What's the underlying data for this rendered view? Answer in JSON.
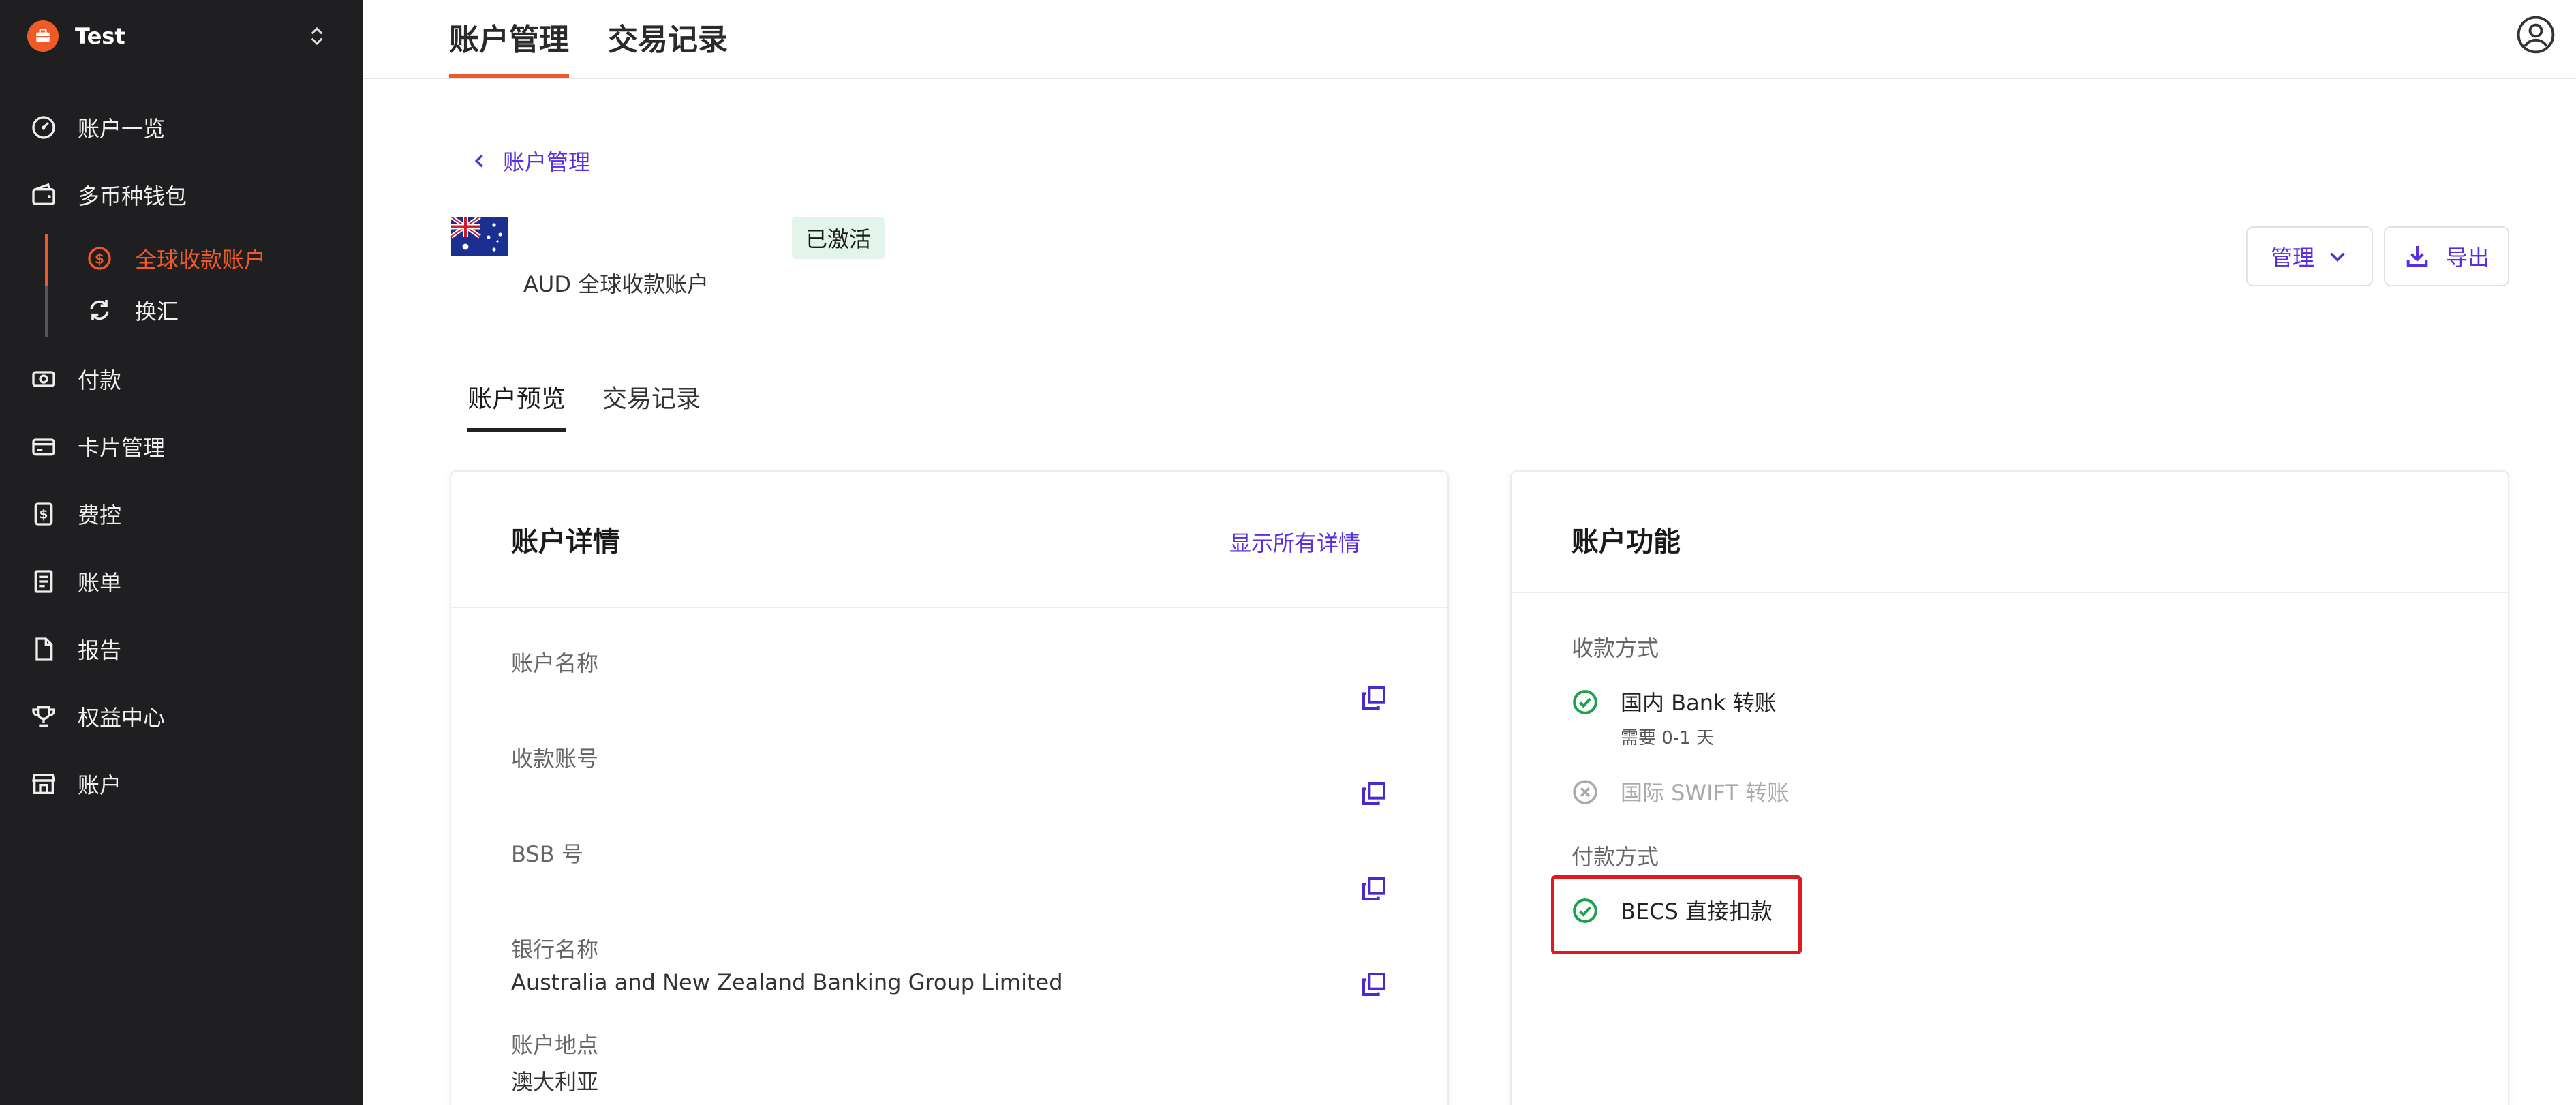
{
  "sidebar": {
    "workspace_name": "Test",
    "items": [
      {
        "label": "账户一览"
      },
      {
        "label": "多币种钱包"
      },
      {
        "label": "付款"
      },
      {
        "label": "卡片管理"
      },
      {
        "label": "费控"
      },
      {
        "label": "账单"
      },
      {
        "label": "报告"
      },
      {
        "label": "权益中心"
      },
      {
        "label": "账户"
      }
    ],
    "sub_items": [
      {
        "label": "全球收款账户",
        "active": true
      },
      {
        "label": "换汇",
        "active": false
      }
    ]
  },
  "header": {
    "tabs": [
      {
        "label": "账户管理",
        "active": true
      },
      {
        "label": "交易记录",
        "active": false
      }
    ]
  },
  "account": {
    "back_label": "账户管理",
    "status_badge": "已激活",
    "title": "AUD 全球收款账户",
    "manage_label": "管理",
    "export_label": "导出"
  },
  "content_tabs": [
    {
      "label": "账户预览",
      "active": true
    },
    {
      "label": "交易记录",
      "active": false
    }
  ],
  "details_card": {
    "title": "账户详情",
    "link": "显示所有详情",
    "fields": [
      {
        "label": "账户名称",
        "value": ""
      },
      {
        "label": "收款账号",
        "value": ""
      },
      {
        "label": "BSB 号",
        "value": ""
      },
      {
        "label": "银行名称",
        "value": "Australia and New Zealand Banking Group Limited"
      },
      {
        "label": "账户地点",
        "value": "澳大利亚"
      }
    ]
  },
  "features_card": {
    "title": "账户功能",
    "receive_label": "收款方式",
    "receive_methods": [
      {
        "name": "国内 Bank 转账",
        "sub": "需要 0-1 天",
        "enabled": true
      },
      {
        "name": "国际 SWIFT 转账",
        "sub": "",
        "enabled": false
      }
    ],
    "pay_label": "付款方式",
    "pay_methods": [
      {
        "name": "BECS 直接扣款",
        "enabled": true
      }
    ]
  },
  "colors": {
    "sidebar_bg": "#1f1f21",
    "accent_orange": "#f05a28",
    "link_purple": "#5a2fe0",
    "success_green": "#1aa34a",
    "highlight_red": "#e0191e"
  }
}
